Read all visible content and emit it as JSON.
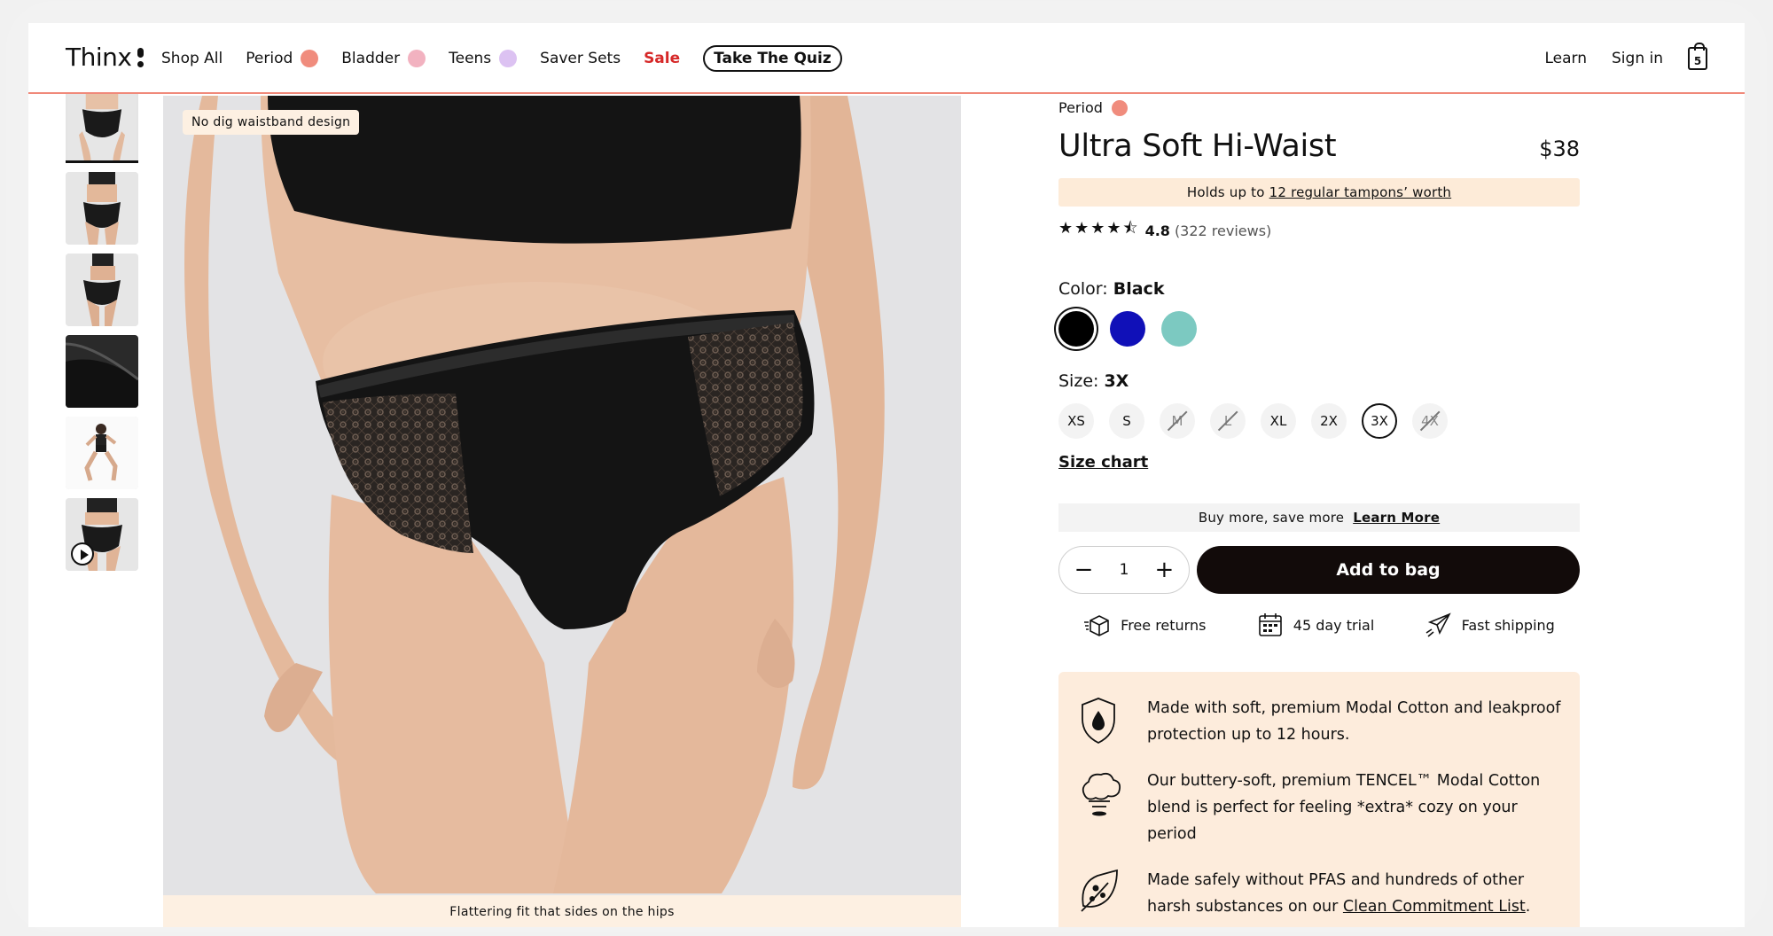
{
  "header": {
    "logo": "Thinx",
    "nav": [
      {
        "label": "Shop All",
        "dot": null
      },
      {
        "label": "Period",
        "dot": "#f08c7d"
      },
      {
        "label": "Bladder",
        "dot": "#f2b2c0"
      },
      {
        "label": "Teens",
        "dot": "#dcc2f2"
      },
      {
        "label": "Saver Sets",
        "dot": null
      },
      {
        "label": "Sale",
        "dot": null
      }
    ],
    "quiz_label": "Take The Quiz",
    "learn": "Learn",
    "sign_in": "Sign in",
    "cart_count": "5"
  },
  "gallery": {
    "image_tag": "No dig waistband design",
    "caption": "Flattering fit that sides on the hips"
  },
  "product": {
    "category": "Period",
    "category_color": "#f08c7d",
    "title": "Ultra Soft Hi-Waist",
    "price": "$38",
    "holds_prefix": "Holds up to",
    "holds_link": "12 regular tampons’ worth",
    "stars": "★★★★⯪",
    "rating": "4.8",
    "reviews": "(322 reviews)",
    "color_label": "Color:",
    "color_value": "Black",
    "colors": [
      "#000000",
      "#1010b8",
      "#7cc9c1"
    ],
    "size_label": "Size:",
    "size_value": "3X",
    "sizes": [
      "XS",
      "S",
      "M",
      "L",
      "XL",
      "2X",
      "3X",
      "4X"
    ],
    "size_chart": "Size chart",
    "buy_more": "Buy more, save more",
    "learn_more": "Learn More",
    "quantity": "1",
    "add_to_bag": "Add to bag",
    "perks": [
      "Free returns",
      "45 day trial",
      "Fast shipping"
    ],
    "features": [
      {
        "text": "Made with soft, premium Modal Cotton and leakproof protection up to 12 hours."
      },
      {
        "text": "Our buttery-soft, premium TENCEL™ Modal Cotton blend is perfect for feeling *extra* cozy on your period"
      },
      {
        "text": "Made safely without PFAS and hundreds of other harsh substances on our",
        "link": "Clean Commitment List",
        "suffix": "."
      }
    ]
  }
}
